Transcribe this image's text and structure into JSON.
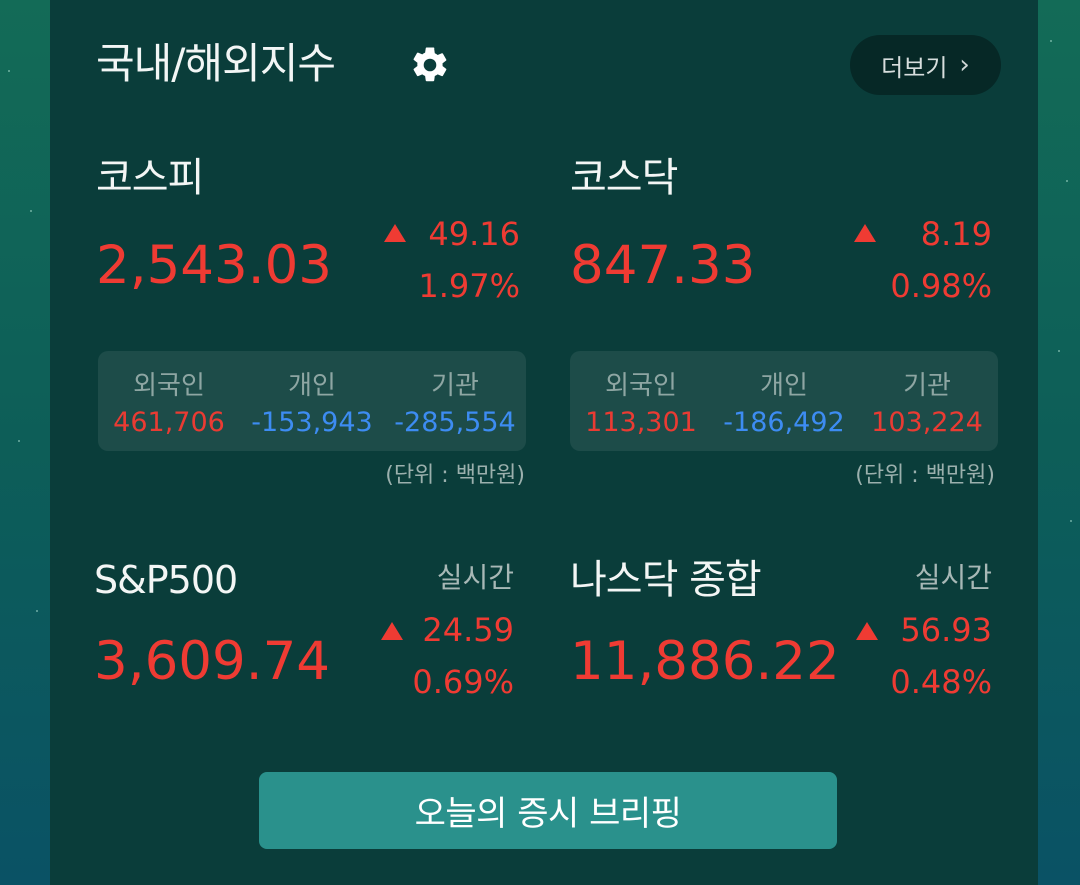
{
  "header": {
    "title": "국내/해외지수",
    "settings_icon": "gear-icon",
    "more_label": "더보기",
    "more_icon": "chevron-right-icon"
  },
  "domestic": {
    "kospi": {
      "name": "코스피",
      "value": "2,543.03",
      "change": "49.16",
      "percent": "1.97%",
      "direction": "up",
      "investors": [
        {
          "label": "외국인",
          "value": "461,706",
          "sign": "pos"
        },
        {
          "label": "개인",
          "value": "-153,943",
          "sign": "neg"
        },
        {
          "label": "기관",
          "value": "-285,554",
          "sign": "neg"
        }
      ],
      "unit": "(단위 : 백만원)"
    },
    "kosdaq": {
      "name": "코스닥",
      "value": "847.33",
      "change": "8.19",
      "percent": "0.98%",
      "direction": "up",
      "investors": [
        {
          "label": "외국인",
          "value": "113,301",
          "sign": "pos"
        },
        {
          "label": "개인",
          "value": "-186,492",
          "sign": "neg"
        },
        {
          "label": "기관",
          "value": "103,224",
          "sign": "pos"
        }
      ],
      "unit": "(단위 : 백만원)"
    }
  },
  "overseas": {
    "sp500": {
      "name": "S&P500",
      "realtime": "실시간",
      "value": "3,609.74",
      "change": "24.59",
      "percent": "0.69%",
      "direction": "up"
    },
    "nasdaq": {
      "name": "나스닥 종합",
      "realtime": "실시간",
      "value": "11,886.22",
      "change": "56.93",
      "percent": "0.48%",
      "direction": "up"
    }
  },
  "footer": {
    "brief_button": "오늘의 증시 브리핑"
  },
  "colors": {
    "up": "#ef3b33",
    "down": "#3d8cf2",
    "panel": "#0a3d3a",
    "button": "#2a918c"
  }
}
